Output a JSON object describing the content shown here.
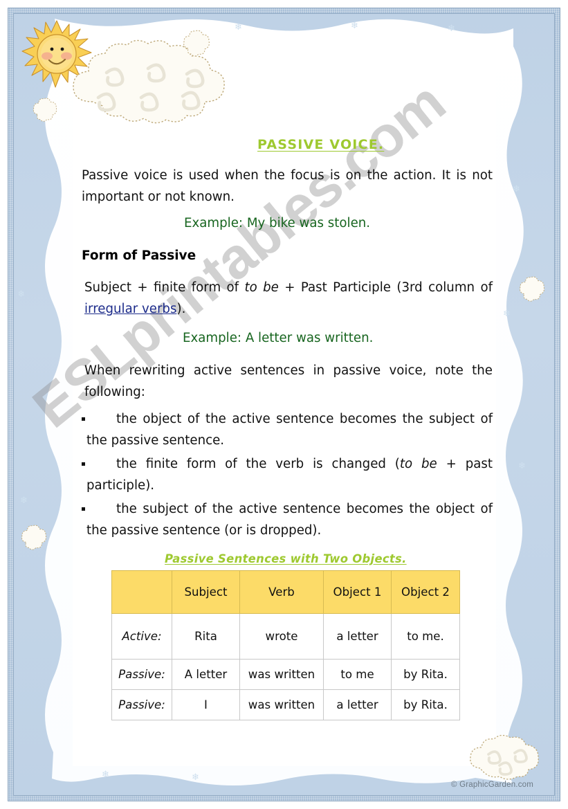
{
  "document": {
    "title": "PASSIVE VOICE.",
    "title_color": "#9ec930",
    "credit": "© GraphicGarden.com",
    "watermark": "ESLprintables.com"
  },
  "intro": {
    "paragraph_before": "Passive voice is used when the focus is on the action. It is not important or not known.",
    "example": "Example: My bike was stolen."
  },
  "form_section": {
    "heading": "Form of Passive",
    "rule_part1": "Subject + finite form of ",
    "rule_italic": "to be",
    "rule_part2": " + Past Participle (3rd column of ",
    "rule_link": "irregular verbs",
    "rule_part3": ").",
    "example": "Example: A letter was written."
  },
  "rewrite_section": {
    "lead_in": "When rewriting active sentences in passive voice, note the following:",
    "bullets": [
      {
        "text_part1": "the object of the active sentence becomes the subject of the passive sentence.",
        "italic": "",
        "text_part2": ""
      },
      {
        "text_part1": "the finite form of the verb is changed (",
        "italic": "to be",
        "text_part2": " + past participle)."
      },
      {
        "text_part1": "the subject of the active sentence becomes the object of the passive sentence (or is dropped).",
        "italic": "",
        "text_part2": ""
      }
    ]
  },
  "table_section": {
    "caption": "Passive Sentences with Two Objects.",
    "header_bg": "#fcdb68",
    "headers": [
      "",
      "Subject",
      "Verb",
      "Object 1",
      "Object 2"
    ],
    "rows": [
      {
        "label": "Active:",
        "subject": "Rita",
        "verb": "wrote",
        "object1": "a letter",
        "object2": "to me."
      },
      {
        "label": "Passive:",
        "subject": "A letter",
        "verb": "was written",
        "object1": "to me",
        "object2": "by Rita."
      },
      {
        "label": "Passive:",
        "subject": "I",
        "verb": "was written",
        "object1": "a letter",
        "object2": "by Rita."
      }
    ]
  },
  "decor": {
    "sun": "sun-icon",
    "cloud": "cloud-icon",
    "puff": "cloud-puff-icon"
  }
}
